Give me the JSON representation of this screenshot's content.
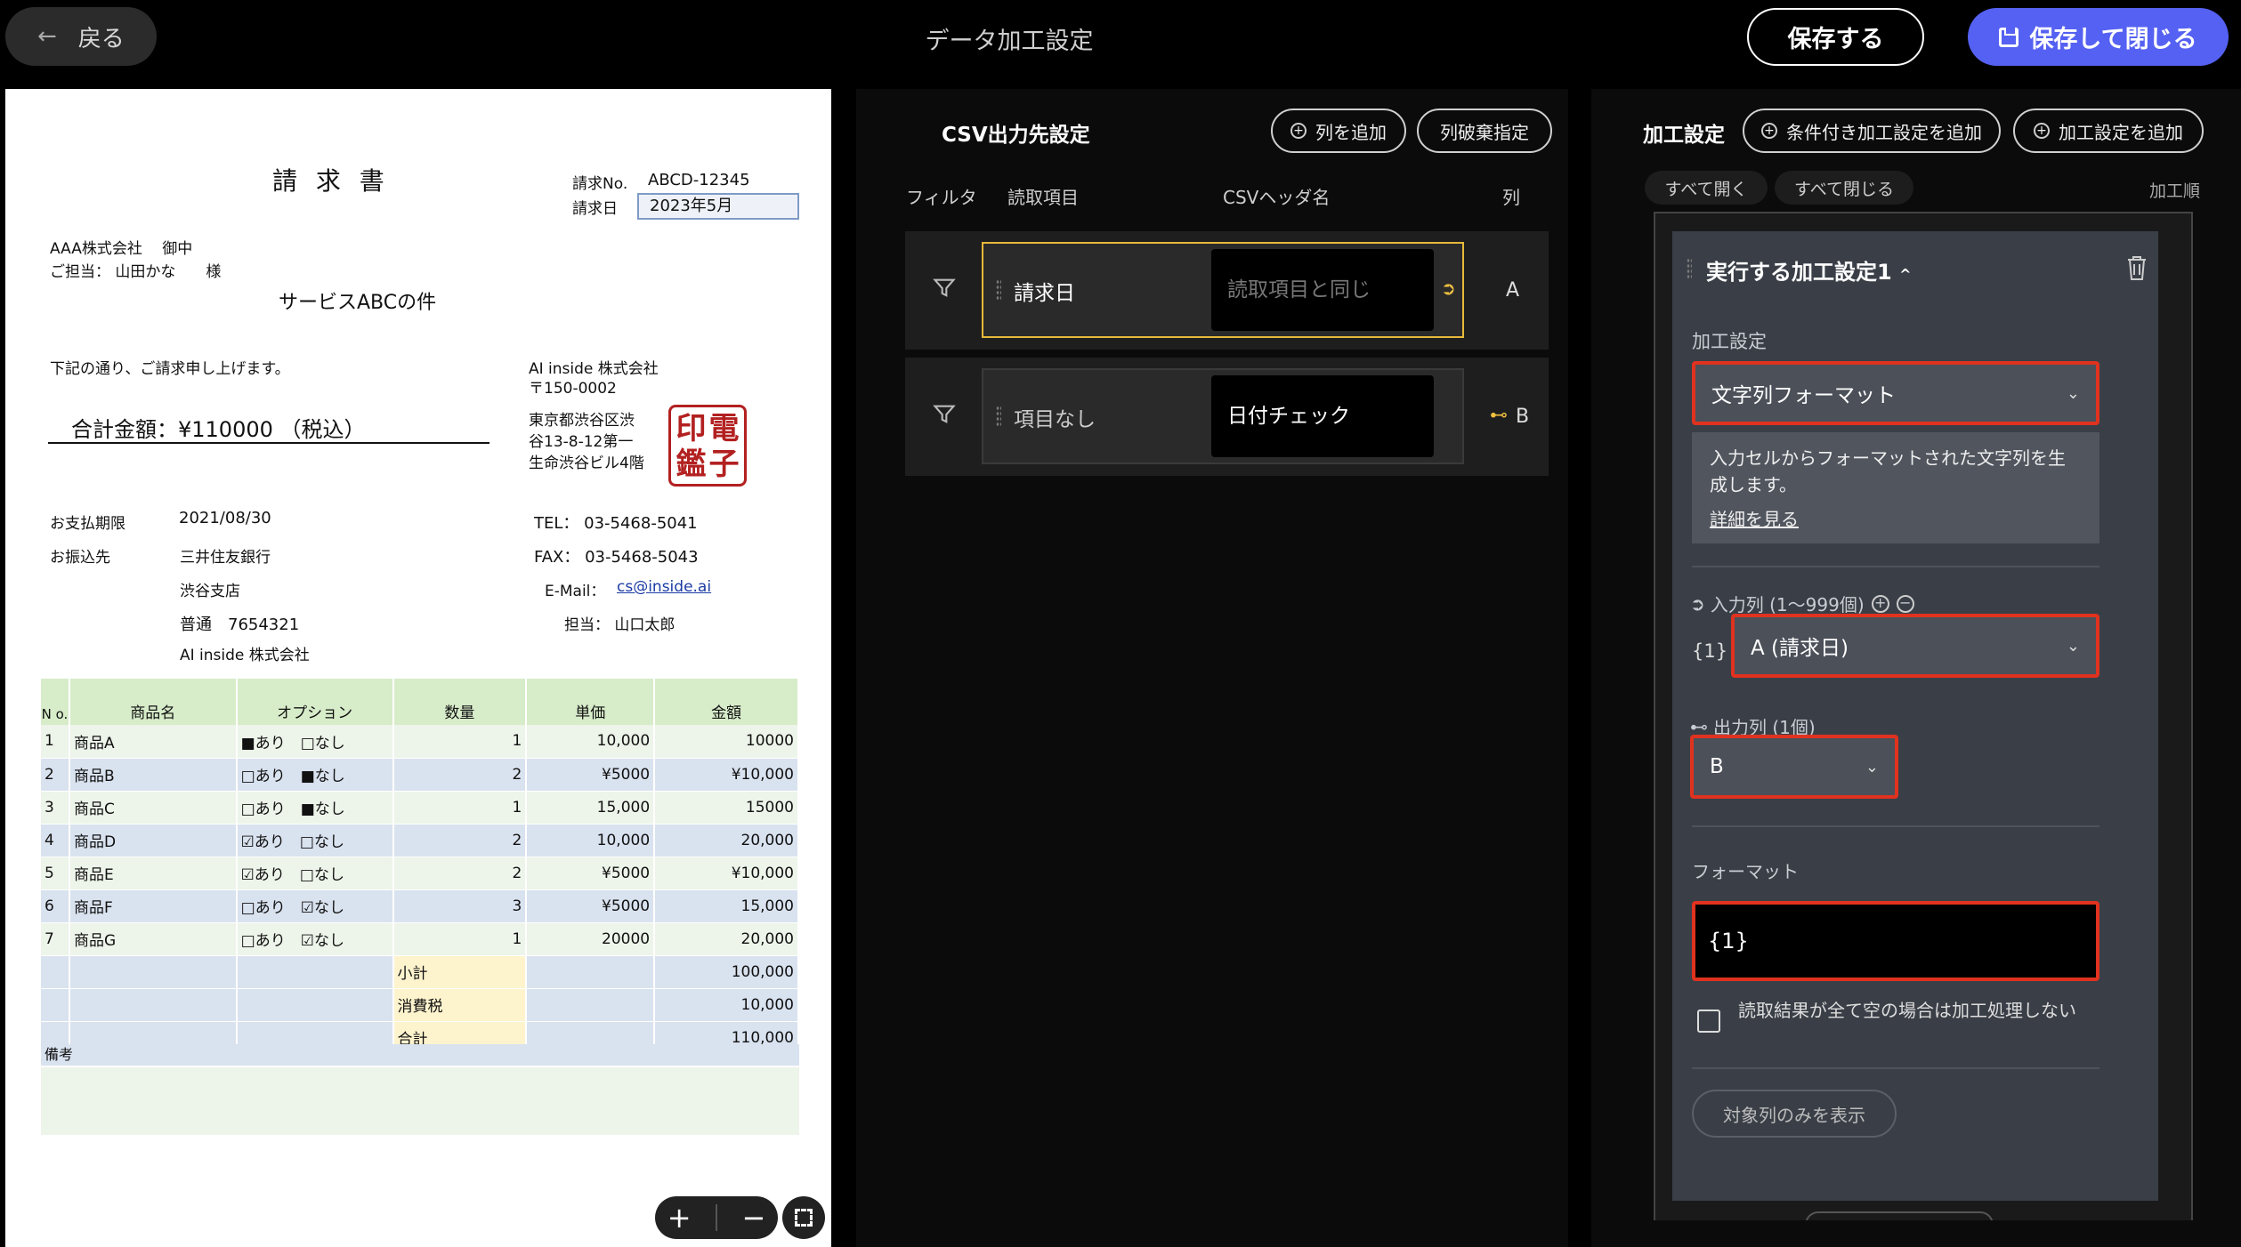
{
  "header": {
    "back_label": "戻る",
    "title": "データ加工設定",
    "save_label": "保存する",
    "save_close_label": "保存して閉じる"
  },
  "document": {
    "title": "請 求 書",
    "invoice_no_label": "請求No.",
    "invoice_no": "ABCD-12345",
    "invoice_date_label": "請求日",
    "invoice_date": "2023年5月",
    "client": "AAA株式会社　 御中",
    "contact": "ご担当： 山田かな　　様",
    "subject": "サービスABCの件",
    "intro": "下記の通り、ご請求申し上げます。",
    "total": "合計金額：¥110000 （税込）",
    "company_name": "AI inside 株式会社",
    "postal": "〒150-0002",
    "address1": "東京都渋谷区渋",
    "address2": "谷13-8-12第一",
    "address3": "生命渋谷ビル4階",
    "stamp_chars": [
      "電",
      "印",
      "子",
      "鑑"
    ],
    "due_label": "お支払期限",
    "due_date": "2021/08/30",
    "bank_label": "お振込先",
    "bank_name": "三井住友銀行",
    "bank_branch": "渋谷支店",
    "bank_account": "普通　7654321",
    "bank_holder": "AI inside 株式会社",
    "tel": "TEL： 03-5468-5041",
    "fax": "FAX： 03-5468-5043",
    "email_label": "E-Mail：",
    "email": "cs@inside.ai",
    "person": "担当： 山口太郎",
    "table_headers": [
      "N\no.",
      "商品名",
      "オプション",
      "数量",
      "単価",
      "金額"
    ],
    "rows": [
      [
        "1",
        "商品A",
        "■あり　□なし",
        "1",
        "10,000",
        "10000"
      ],
      [
        "2",
        "商品B",
        "□あり　■なし",
        "2",
        "¥5000",
        "¥10,000"
      ],
      [
        "3",
        "商品C",
        "□あり　■なし",
        "1",
        "15,000",
        "15000"
      ],
      [
        "4",
        "商品D",
        "☑あり　□なし",
        "2",
        "10,000",
        "20,000"
      ],
      [
        "5",
        "商品E",
        "☑あり　□なし",
        "2",
        "¥5000",
        "¥10,000"
      ],
      [
        "6",
        "商品F",
        "□あり　☑なし",
        "3",
        "¥5000",
        "15,000"
      ],
      [
        "7",
        "商品G",
        "□あり　☑なし",
        "1",
        "20000",
        "20,000"
      ]
    ],
    "subtotal_label": "小計",
    "subtotal": "100,000",
    "tax_label": "消費税",
    "tax": "10,000",
    "grand_label": "合計",
    "grand": "110,000",
    "remarks_label": "備考"
  },
  "csv": {
    "title": "CSV出力先設定",
    "add_col_label": "列を追加",
    "discard_col_label": "列破棄指定",
    "col_headers": [
      "フィルタ",
      "読取項目",
      "CSVヘッダ名",
      "列"
    ],
    "rows": [
      {
        "read_item": "請求日",
        "header_name": "",
        "header_placeholder": "読取項目と同じ",
        "col": "A"
      },
      {
        "read_item": "項目なし",
        "header_name": "日付チェック",
        "header_placeholder": "",
        "col": "B"
      }
    ]
  },
  "processing": {
    "title": "加工設定",
    "add_cond_label": "条件付き加工設定を追加",
    "add_label": "加工設定を追加",
    "expand_all": "すべて開く",
    "collapse_all": "すべて閉じる",
    "order_label": "加工順",
    "card_title": "実行する加工設定1",
    "setting_label": "加工設定",
    "setting_value": "文字列フォーマット",
    "description": "入力セルからフォーマットされた文字列を生成します。",
    "more_link": "詳細を見る",
    "input_label": "入力列 (1〜999個)",
    "input_brace": "{1}",
    "input_value": "A (請求日)",
    "output_label": "出力列 (1個)",
    "output_value": "B",
    "format_label": "フォーマット",
    "format_value": "{1}",
    "skip_label": "読取結果が全て空の場合は加工処理しない",
    "target_only_label": "対象列のみを表示"
  }
}
